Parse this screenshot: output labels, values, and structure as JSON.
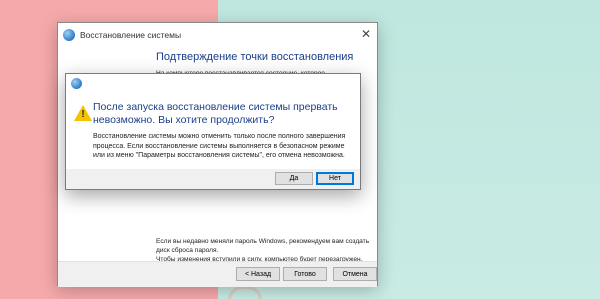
{
  "window": {
    "title": "Восстановление системы",
    "close_glyph": "✕",
    "heading": "Подтверждение точки восстановления",
    "intro_text": "На компьютере восстанавливается состояние, которое предшествовало событию, указанному в поле «Описание».",
    "password_note": "Если вы недавно меняли пароль Windows, рекомендуем вам создать диск сброса пароля.",
    "restart_note": "Чтобы изменения вступили в силу, компьютер будет перезагружен. Прежде чем продолжить, сохраните все открытые файлы и закройте все программы.",
    "buttons": {
      "back": "< Назад",
      "finish": "Готово",
      "cancel": "Отмена"
    }
  },
  "dialog": {
    "heading": "После запуска восстановление системы прервать невозможно. Вы хотите продолжить?",
    "body": "Восстановление системы можно отменить только после полного завершения процесса. Если восстановление системы выполняется в безопасном режиме или из меню \"Параметры восстановления системы\", его отмена невозможна.",
    "warning_glyph": "!",
    "buttons": {
      "yes": "Да",
      "no": "Нет"
    }
  }
}
